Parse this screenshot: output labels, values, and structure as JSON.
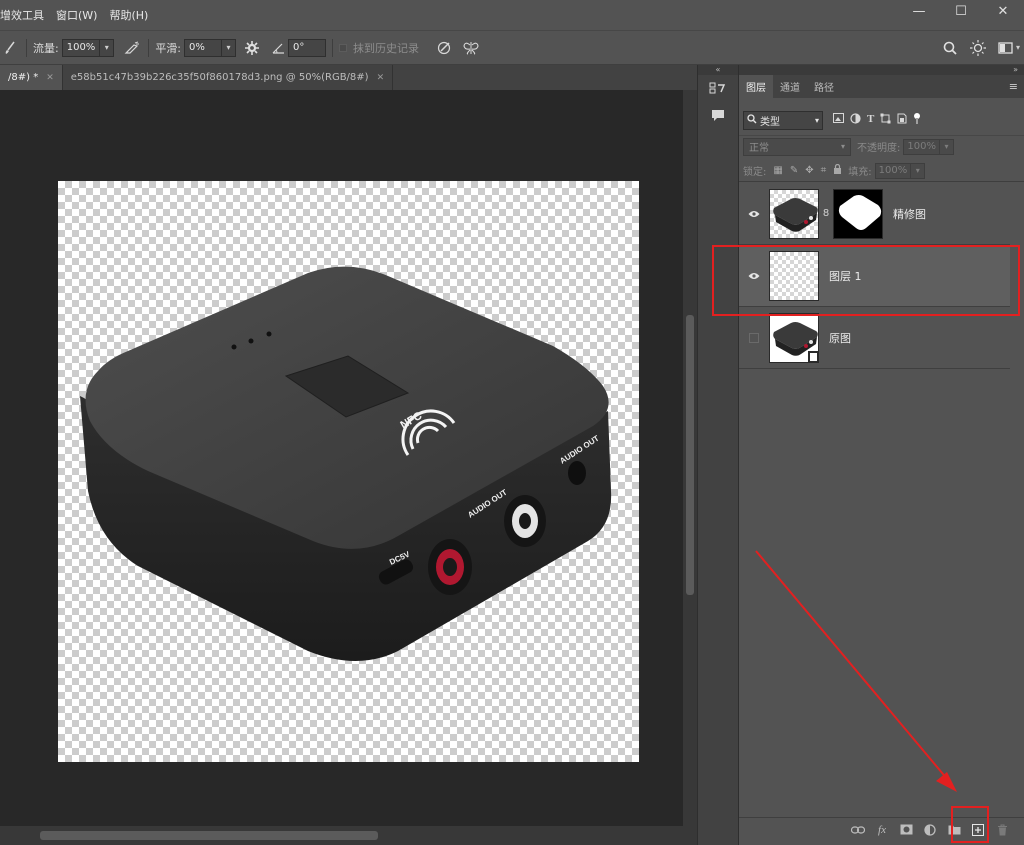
{
  "menubar": {
    "items": [
      "增效工具",
      "窗口(W)",
      "帮助(H)"
    ],
    "window_controls": [
      "—",
      "☐",
      "✕"
    ]
  },
  "options": {
    "flow_label": "流量:",
    "flow_value": "100%",
    "smooth_label": "平滑:",
    "smooth_value": "0%",
    "angle_value": "0°",
    "history_label": "抹到历史记录"
  },
  "tabs": [
    {
      "label": "/8#) *",
      "active": true
    },
    {
      "label": "e58b51c47b39b226c35f50f860178d3.png @ 50%(RGB/8#)",
      "active": false
    }
  ],
  "product": {
    "nfc_label": "NFC",
    "audio_out_1": "AUDIO OUT",
    "audio_out_2": "AUDIO OUT",
    "power_label": "DC5V"
  },
  "panel": {
    "tabs": [
      "图层",
      "通道",
      "路径"
    ],
    "filter_label": "类型",
    "blend_mode": "正常",
    "opacity_label": "不透明度:",
    "opacity_value": "100%",
    "lock_label": "锁定:",
    "fill_label": "填充:",
    "fill_value": "100%"
  },
  "layers": [
    {
      "name": "精修图",
      "visible": true,
      "has_mask": true,
      "selected": false
    },
    {
      "name": "图层 1",
      "visible": true,
      "has_mask": false,
      "selected": true
    },
    {
      "name": "原图",
      "visible": false,
      "has_mask": false,
      "selected": false
    }
  ],
  "colors": {
    "annotation": "#e32020",
    "ui_bg": "#535353",
    "canvas_bg": "#282828"
  }
}
